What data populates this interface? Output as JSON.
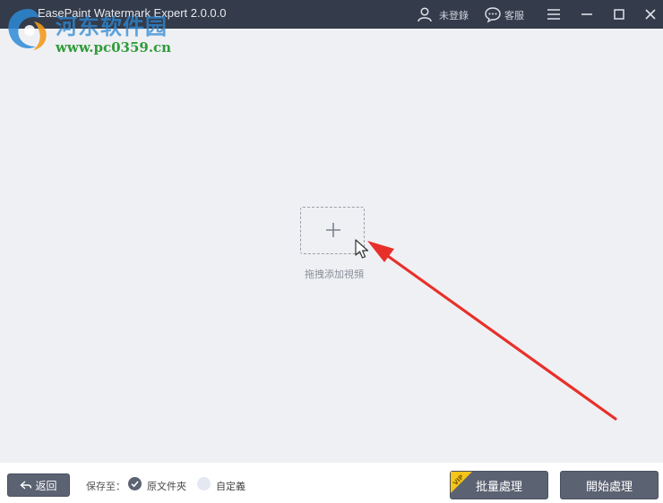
{
  "app": {
    "title": "EasePaint Watermark Expert  2.0.0.0"
  },
  "header": {
    "login_label": "未登錄",
    "service_label": "客服"
  },
  "watermark": {
    "site_name": "河东软件园",
    "url": "www.pc0359.cn"
  },
  "drop_zone": {
    "label": "拖拽添加視頻"
  },
  "bottom": {
    "back_label": "返回",
    "save_to_label": "保存至：",
    "options": [
      {
        "label": "原文件夾",
        "selected": true
      },
      {
        "label": "自定義",
        "selected": false
      }
    ],
    "batch_label": "批量處理",
    "start_label": "開始處理",
    "vip_label": "VIP"
  },
  "colors": {
    "titlebar": "#343b4a",
    "background": "#eff0f3",
    "button": "#5b6272",
    "annotation_arrow": "#e8302a",
    "vip": "#f5c518"
  },
  "icons": {
    "user": "user-icon",
    "chat": "chat-icon",
    "menu": "hamburger-icon",
    "minimize": "minimize-icon",
    "maximize": "maximize-icon",
    "close": "close-icon",
    "plus": "plus-icon",
    "back": "back-arrow-icon",
    "check": "check-icon"
  }
}
